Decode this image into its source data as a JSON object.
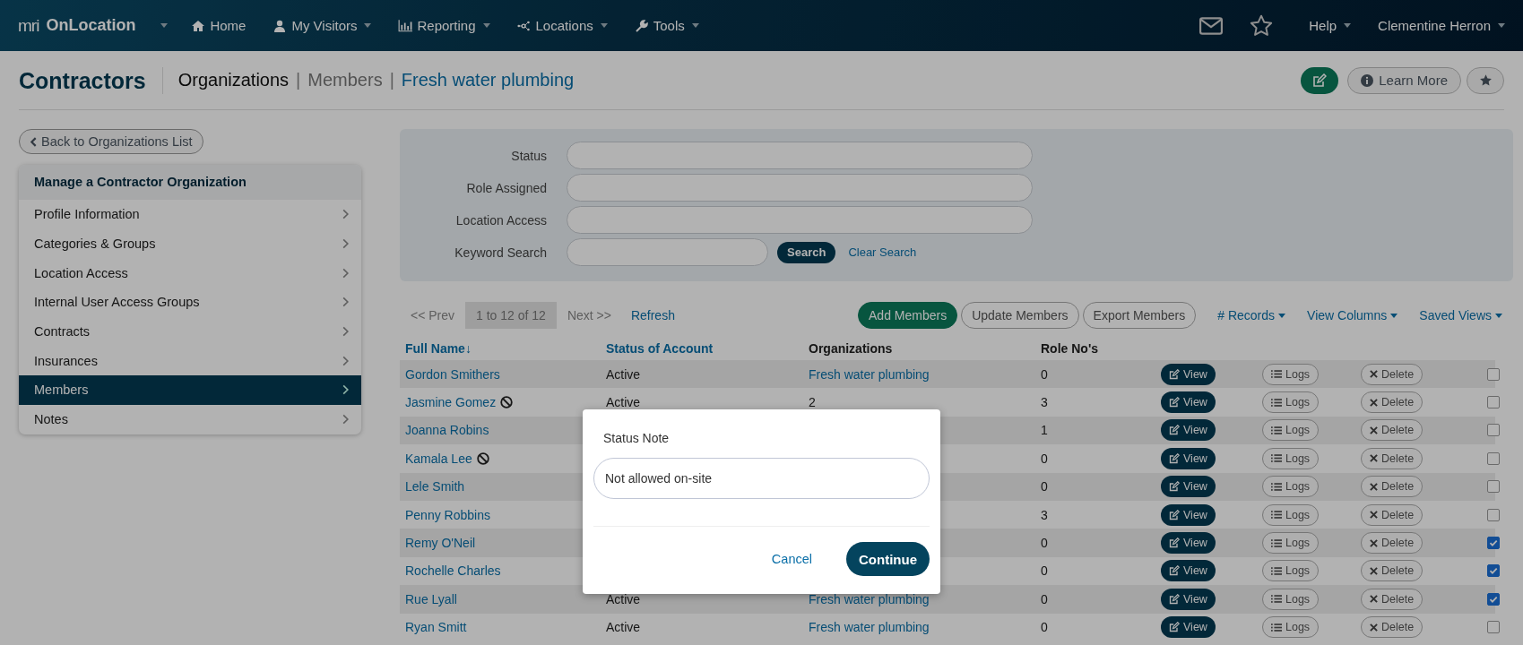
{
  "navbar": {
    "logo": "mri",
    "product": "OnLocation",
    "items": [
      {
        "label": "Home",
        "menu": false
      },
      {
        "label": "My Visitors",
        "menu": true
      },
      {
        "label": "Reporting",
        "menu": true
      },
      {
        "label": "Locations",
        "menu": true
      },
      {
        "label": "Tools",
        "menu": true
      }
    ],
    "help": "Help",
    "user": "Clementine Herron"
  },
  "header": {
    "title": "Contractors",
    "separator": "|",
    "breadcrumb": [
      {
        "text": "Organizations",
        "kind": "current"
      },
      {
        "text": "Members",
        "kind": "muted"
      },
      {
        "text": "Fresh water plumbing",
        "kind": "link"
      }
    ],
    "learn_more": "Learn More"
  },
  "sidebar": {
    "back": "Back to Organizations List",
    "title": "Manage a Contractor Organization",
    "items": [
      {
        "label": "Profile Information",
        "selected": false
      },
      {
        "label": "Categories & Groups",
        "selected": false
      },
      {
        "label": "Location Access",
        "selected": false
      },
      {
        "label": "Internal User Access Groups",
        "selected": false
      },
      {
        "label": "Contracts",
        "selected": false
      },
      {
        "label": "Insurances",
        "selected": false
      },
      {
        "label": "Members",
        "selected": true
      },
      {
        "label": "Notes",
        "selected": false
      }
    ]
  },
  "filters": {
    "fields": [
      {
        "label": "Status"
      },
      {
        "label": "Role Assigned"
      },
      {
        "label": "Location Access"
      }
    ],
    "keyword": {
      "label": "Keyword Search",
      "search": "Search",
      "clear": "Clear Search"
    }
  },
  "toolbar": {
    "prev": "<< Prev",
    "range": "1 to 12 of 12",
    "next": "Next >>",
    "refresh": "Refresh",
    "buttons": [
      {
        "label": "Add Members",
        "kind": "primary"
      },
      {
        "label": "Update Members",
        "kind": "outline"
      },
      {
        "label": "Export Members",
        "kind": "outline"
      }
    ],
    "menus": [
      "# Records",
      "View Columns",
      "Saved Views"
    ]
  },
  "table": {
    "columns": [
      {
        "label": "Full Name",
        "sortable": true,
        "sort_indicator": "↓"
      },
      {
        "label": "Status of Account",
        "sortable": true
      },
      {
        "label": "Organizations",
        "sortable": false
      },
      {
        "label": "Role No's",
        "sortable": false
      }
    ],
    "rows": [
      {
        "name": "Gordon Smithers",
        "blocked": false,
        "status": "Active",
        "organization": "Fresh water plumbing",
        "org_link": true,
        "roles": "0",
        "actions": [
          "View",
          "Logs",
          "Delete"
        ],
        "checked": false
      },
      {
        "name": "Jasmine Gomez",
        "blocked": true,
        "status": "Active",
        "organization": "2",
        "org_link": false,
        "roles": "3",
        "actions": [
          "View",
          "Logs",
          "Delete"
        ],
        "checked": false
      },
      {
        "name": "Joanna Robins",
        "blocked": false,
        "roles": "1",
        "actions": [
          "View",
          "Logs",
          "Delete"
        ],
        "checked": false
      },
      {
        "name": "Kamala Lee",
        "blocked": true,
        "roles": "0",
        "actions": [
          "View",
          "Logs",
          "Delete"
        ],
        "checked": false
      },
      {
        "name": "Lele Smith",
        "blocked": false,
        "roles": "0",
        "actions": [
          "View",
          "Logs",
          "Delete"
        ],
        "checked": false
      },
      {
        "name": "Penny Robbins",
        "blocked": false,
        "roles": "3",
        "actions": [
          "View",
          "Logs",
          "Delete"
        ],
        "checked": false
      },
      {
        "name": "Remy O'Neil",
        "blocked": false,
        "roles": "0",
        "actions": [
          "View",
          "Logs",
          "Delete"
        ],
        "checked": true
      },
      {
        "name": "Rochelle Charles",
        "blocked": false,
        "roles": "0",
        "actions": [
          "View",
          "Logs",
          "Delete"
        ],
        "checked": true
      },
      {
        "name": "Rue Lyall",
        "blocked": false,
        "status": "Active",
        "organization": "Fresh water plumbing",
        "org_link": true,
        "roles": "0",
        "actions": [
          "View",
          "Logs",
          "Delete"
        ],
        "checked": true
      },
      {
        "name": "Ryan Smitt",
        "blocked": false,
        "status": "Active",
        "organization": "Fresh water plumbing",
        "org_link": true,
        "roles": "0",
        "actions": [
          "View",
          "Logs",
          "Delete"
        ],
        "checked": false
      }
    ]
  },
  "modal": {
    "label": "Status Note",
    "value": "Not allowed on-site",
    "cancel": "Cancel",
    "confirm": "Continue"
  }
}
